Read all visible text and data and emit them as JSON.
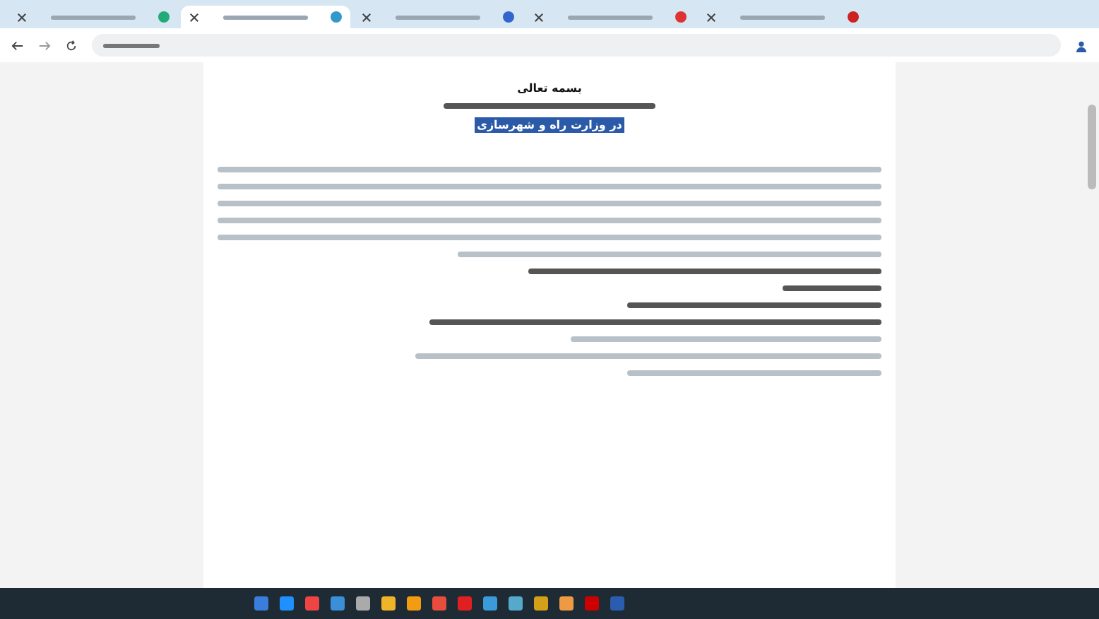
{
  "tabs": [
    {
      "selected": false
    },
    {
      "selected": true
    },
    {
      "selected": false
    },
    {
      "selected": false
    },
    {
      "selected": false
    }
  ],
  "document": {
    "title": "بسمه تعالی",
    "highlight": "در وزارت راه و شهرسازی"
  }
}
